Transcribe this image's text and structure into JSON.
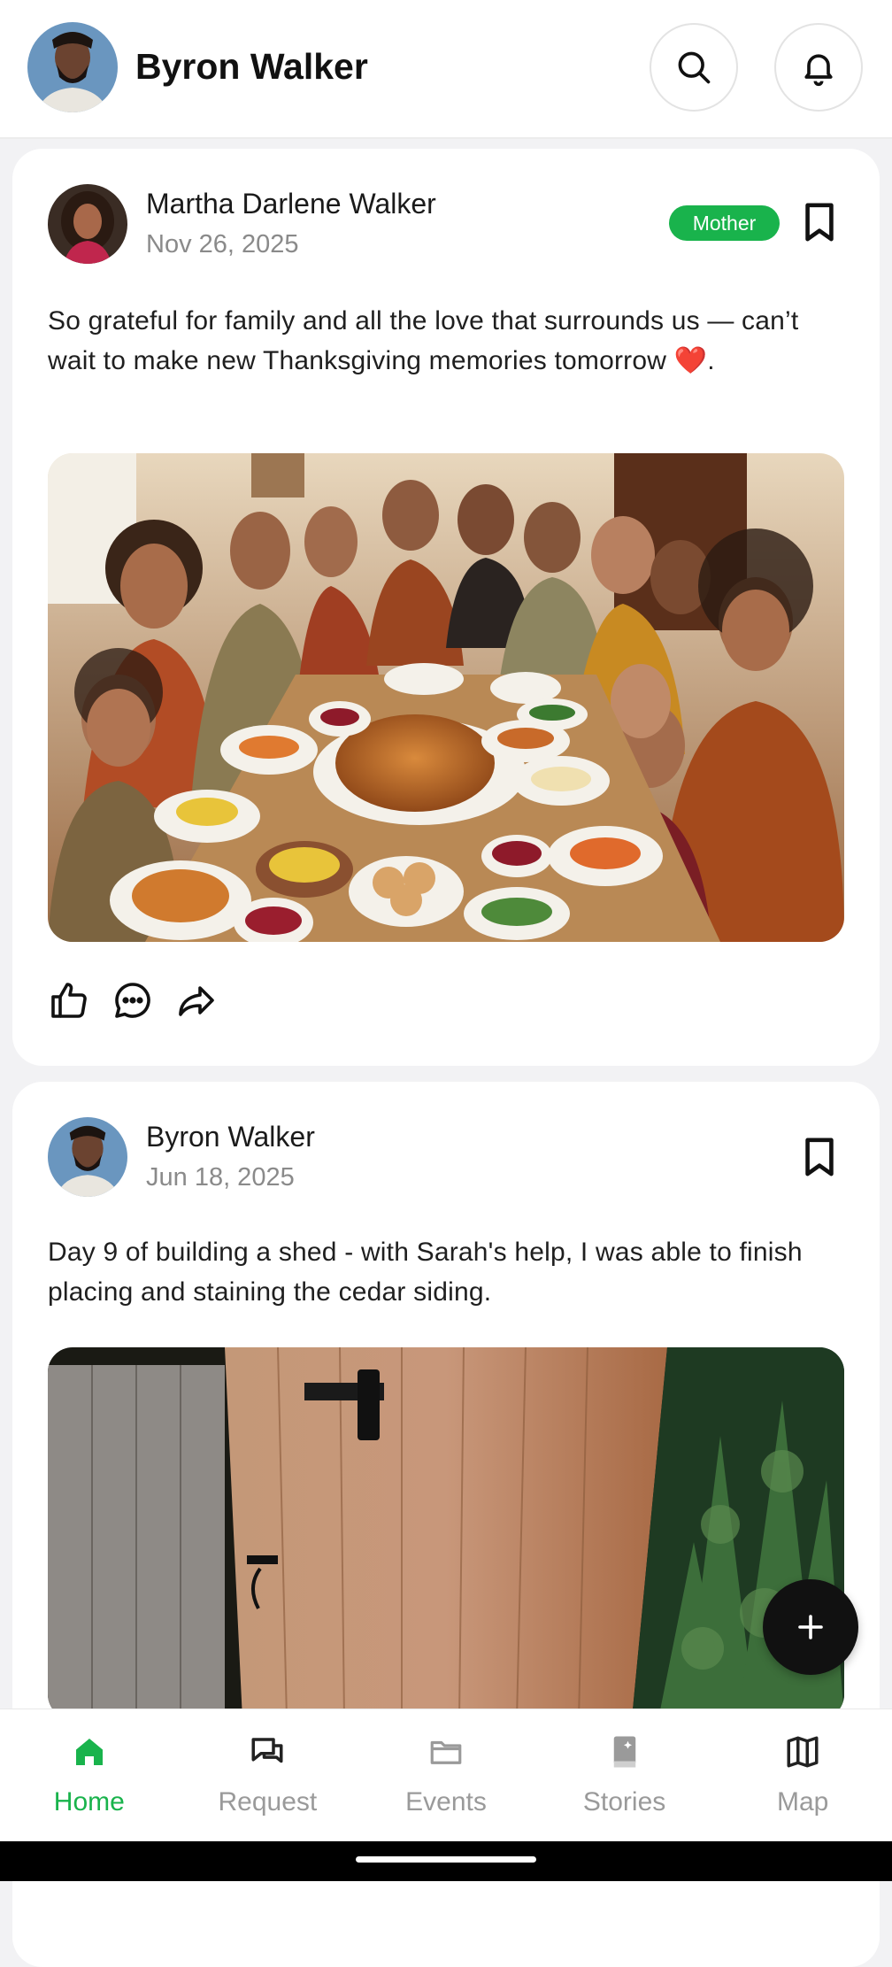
{
  "header": {
    "name": "Byron Walker"
  },
  "posts": [
    {
      "author": "Martha Darlene Walker",
      "date": "Nov 26, 2025",
      "badge": "Mother",
      "text": "So grateful for family and all the love that surrounds us — can’t wait to make new Thanksgiving memories tomorrow ❤️."
    },
    {
      "author": "Byron Walker",
      "date": "Jun 18, 2025",
      "text": "Day 9 of building a shed - with Sarah's help, I was able to finish placing and staining the cedar siding."
    }
  ],
  "nav": {
    "items": [
      {
        "label": "Home",
        "icon": "home-icon",
        "active": true
      },
      {
        "label": "Request",
        "icon": "chat-bubbles-icon"
      },
      {
        "label": "Events",
        "icon": "folder-icon"
      },
      {
        "label": "Stories",
        "icon": "book-icon"
      },
      {
        "label": "Map",
        "icon": "map-icon"
      }
    ]
  },
  "colors": {
    "accent": "#19b34c",
    "fab": "#111111"
  }
}
